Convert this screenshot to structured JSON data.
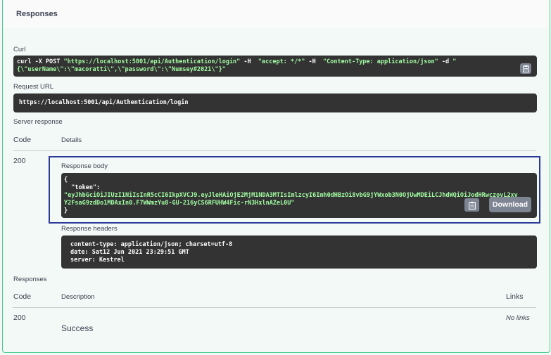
{
  "responses_section": {
    "title": "Responses"
  },
  "curl": {
    "label": "Curl",
    "line1_cmd": "curl -X POST ",
    "line1_url": "\"https://localhost:5001/api/Authentication/login\"",
    "line1_h1": " -H  ",
    "line1_accept": "\"accept: */*\"",
    "line1_h2": " -H  ",
    "line1_ct": "\"Content-Type: application/json\"",
    "line1_d": " -d ",
    "line1_q": "\"",
    "line2": "{\\\"userName\\\":\\\"macoratti\\\",\\\"password\\\":\\\"Numsey#2021\\\"}\""
  },
  "request_url": {
    "label": "Request URL",
    "value": "https://localhost:5001/api/Authentication/login"
  },
  "server_response": {
    "label": "Server response",
    "col_code": "Code",
    "col_details": "Details",
    "code": "200",
    "body_label": "Response body",
    "body_open": "{",
    "body_key": "  \"token\":",
    "body_token_line1": "\"eyJhbGciOiJIUzI1NiIsInR5cCI6IkpXVCJ9.eyJleHAiOjE2MjM1NDA3MTIsImlzcyI6Imh0dHBzOi8vbG9jYWxob3N0OjUwMDEiLCJhdWQiOiJodHRwczovL2xv",
    "body_token_line2": "Y2FsaG9zdDo1MDAxIn0.F7WWmzYu8-GU-216yCS6RFUHW4Fic-rN3HxlnAZeL0U\"",
    "body_close": "}",
    "download_label": "Download",
    "headers_label": "Response headers",
    "headers": [
      "content-type: application/json; charset=utf-8",
      "date: Sat12 Jun 2021 23:29:51 GMT",
      "server: Kestrel"
    ]
  },
  "responses_table": {
    "label": "Responses",
    "col_code": "Code",
    "col_description": "Description",
    "col_links": "Links",
    "row_code": "200",
    "row_description": "Success",
    "row_links": "No links"
  }
}
